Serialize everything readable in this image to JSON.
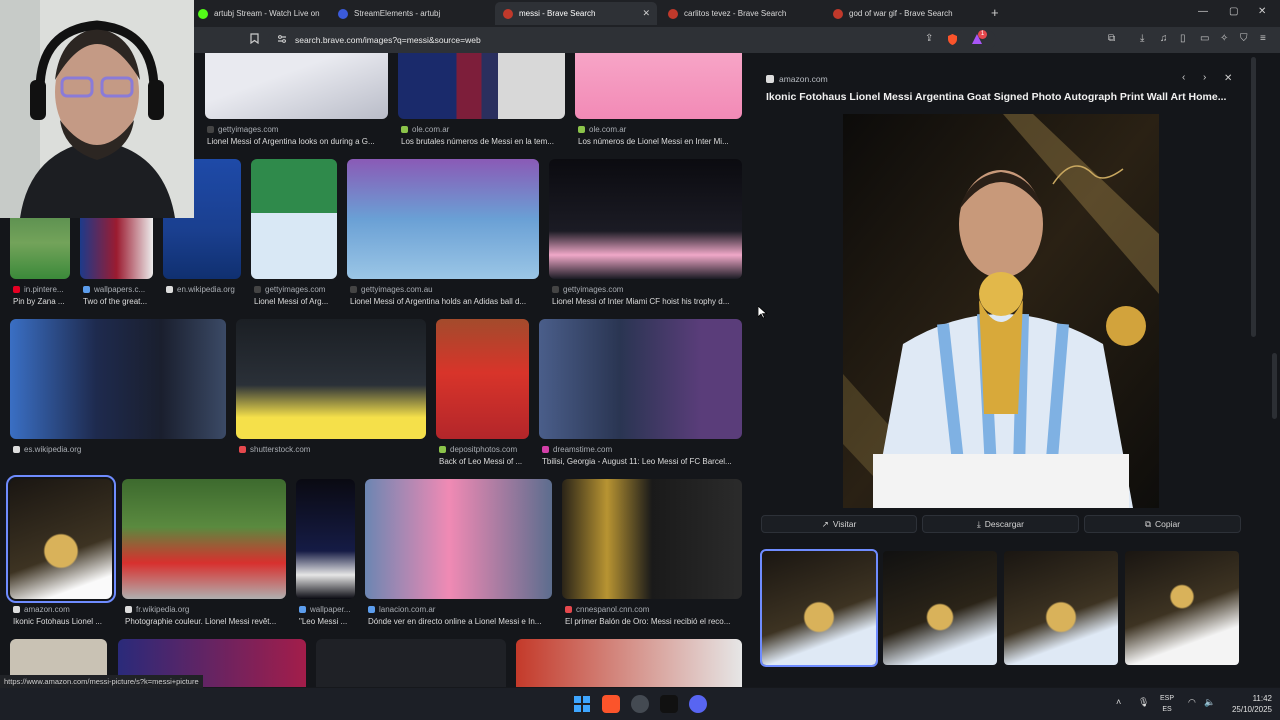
{
  "tabs": [
    {
      "label": "artubj Stream - Watch Live on Ki..."
    },
    {
      "label": "StreamElements - artubj"
    },
    {
      "label": "messi - Brave Search"
    },
    {
      "label": "carlitos tevez - Brave Search"
    },
    {
      "label": "god of war gif - Brave Search"
    }
  ],
  "address": {
    "url": "search.brave.com/images?q=messi&source=web"
  },
  "shields_count": "1",
  "grid": {
    "row1": [
      {
        "source": "gettyimages.com",
        "caption": "Lionel Messi of Argentina looks on during a G..."
      },
      {
        "source": "ole.com.ar",
        "caption": "Los brutales números de Messi en la tem..."
      },
      {
        "source": "ole.com.ar",
        "caption": "Los números de Lionel Messi en Inter Mi..."
      }
    ],
    "row2": [
      {
        "source": "in.pintere...",
        "caption": "Pin by Zana ..."
      },
      {
        "source": "wallpapers.c...",
        "caption": "Two of the great..."
      },
      {
        "source": "en.wikipedia.org",
        "caption": ""
      },
      {
        "source": "gettyimages.com",
        "caption": "Lionel Messi of Arg..."
      },
      {
        "source": "gettyimages.com.au",
        "caption": "Lionel Messi of Argentina holds an Adidas ball d..."
      },
      {
        "source": "gettyimages.com",
        "caption": "Lionel Messi of Inter Miami CF hoist his trophy d..."
      }
    ],
    "row3": [
      {
        "source": "es.wikipedia.org",
        "caption": ""
      },
      {
        "source": "shutterstock.com",
        "caption": ""
      },
      {
        "source": "depositphotos.com",
        "caption": "Back of Leo Messi of ..."
      },
      {
        "source": "dreamstime.com",
        "caption": "Tbilisi, Georgia - August 11: Leo Messi of FC Barcel..."
      }
    ],
    "row4": [
      {
        "source": "amazon.com",
        "caption": "Ikonic Fotohaus Lionel ..."
      },
      {
        "source": "fr.wikipedia.org",
        "caption": "Photographie couleur. Lionel Messi revêt..."
      },
      {
        "source": "wallpaper...",
        "caption": "\"Leo Messi ..."
      },
      {
        "source": "lanacion.com.ar",
        "caption": "Dónde ver en directo online a Lionel Messi e In..."
      },
      {
        "source": "cnnespanol.cnn.com",
        "caption": "El primer Balón de Oro: Messi recibió el reco..."
      }
    ]
  },
  "panel": {
    "domain": "amazon.com",
    "title": "Ikonic Fotohaus Lionel Messi Argentina Goat Signed Photo Autograph Print Wall Art Home...",
    "actions": {
      "visit": "Visitar",
      "download": "Descargar",
      "copy": "Copiar"
    }
  },
  "status_url": "https://www.amazon.com/messi-picture/s?k=messi+picture",
  "system_tray": {
    "lang_top": "ESP",
    "lang_bottom": "ES",
    "time": "11:42",
    "date": "25/10/2025"
  },
  "colors": {
    "accent": "#6f8cff",
    "brave": "#fb542b"
  }
}
